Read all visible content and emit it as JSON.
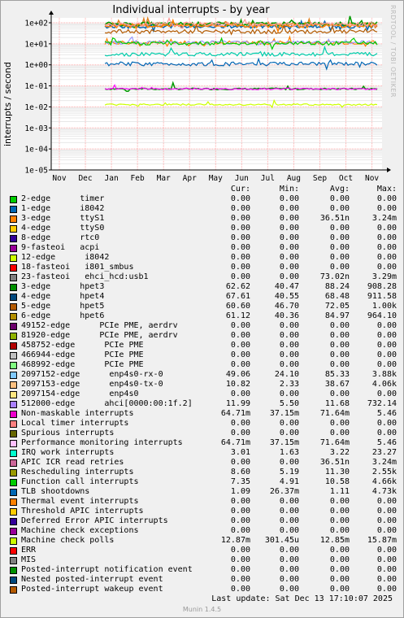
{
  "title": "Individual interrupts - by year",
  "watermark": "RRDTOOL / TOBI OETIKER",
  "chart_data": {
    "type": "line",
    "title": "Individual interrupts - by year",
    "ylabel": "interrupts / second",
    "yscale": "log",
    "ylim": [
      1e-05,
      100
    ],
    "ytick_labels": [
      "1e-05",
      "1e-04",
      "1e-03",
      "1e-02",
      "1e-01",
      "1e+00",
      "1e+01",
      "1e+02"
    ],
    "ytick_values": [
      1e-05,
      0.0001,
      0.001,
      0.01,
      0.1,
      1,
      10,
      100
    ],
    "x_categories": [
      "Nov",
      "Dec",
      "Jan",
      "Feb",
      "Mar",
      "Apr",
      "May",
      "Jun",
      "Jul",
      "Aug",
      "Sep",
      "Oct",
      "Nov"
    ],
    "grid": true,
    "data_start": "Jan",
    "series": [
      {
        "name": "Performance monitoring interrupts",
        "color": "#009900",
        "value": 0.0716
      },
      {
        "name": "hpet6",
        "color": "#e08020",
        "value": 85
      },
      {
        "name": "hpet4",
        "color": "#0066b3",
        "value": 68
      },
      {
        "name": "hpet3",
        "color": "#009900",
        "value": 88
      },
      {
        "name": "hpet5",
        "color": "#ff8000",
        "value": 72
      },
      {
        "name": "enp4s0-rx-0",
        "color": "#ff9999",
        "value": 85
      },
      {
        "name": "enp4s0-tx-0",
        "color": "#b35a00",
        "value": 38
      },
      {
        "name": "Rescheduling interrupts",
        "color": "#ff8000",
        "value": 11.3
      },
      {
        "name": "ahci[0000:00:1f.2]",
        "color": "#9999ff",
        "value": 11.7
      },
      {
        "name": "Function call interrupts",
        "color": "#00cc00",
        "value": 10.6
      },
      {
        "name": "IRQ work interrupts",
        "color": "#00ccaa",
        "value": 3.2
      },
      {
        "name": "TLB shootdowns",
        "color": "#0066b3",
        "value": 1.1
      },
      {
        "name": "Local timer interrupts",
        "color": "#ff00ff",
        "value": 0.0716
      },
      {
        "name": "Machine check polls",
        "color": "#ccff00",
        "value": 0.01285
      }
    ]
  },
  "legend": {
    "headers": {
      "cur": "Cur:",
      "min": "Min:",
      "avg": "Avg:",
      "max": "Max:"
    },
    "rows": [
      {
        "name": "2-edge      timer",
        "color": "#00cc00",
        "cur": "0.00",
        "min": "0.00",
        "avg": "0.00",
        "max": "0.00"
      },
      {
        "name": "1-edge      i8042",
        "color": "#0066b3",
        "cur": "0.00",
        "min": "0.00",
        "avg": "0.00",
        "max": "0.00"
      },
      {
        "name": "3-edge      ttyS1",
        "color": "#ff8000",
        "cur": "0.00",
        "min": "0.00",
        "avg": "36.51n",
        "max": "3.24m"
      },
      {
        "name": "4-edge      ttyS0",
        "color": "#ffcc00",
        "cur": "0.00",
        "min": "0.00",
        "avg": "0.00",
        "max": "0.00"
      },
      {
        "name": "8-edge      rtc0",
        "color": "#330099",
        "cur": "0.00",
        "min": "0.00",
        "avg": "0.00",
        "max": "0.00"
      },
      {
        "name": "9-fasteoi   acpi",
        "color": "#990099",
        "cur": "0.00",
        "min": "0.00",
        "avg": "0.00",
        "max": "0.00"
      },
      {
        "name": "12-edge      i8042",
        "color": "#ccff00",
        "cur": "0.00",
        "min": "0.00",
        "avg": "0.00",
        "max": "0.00"
      },
      {
        "name": "18-fasteoi   i801_smbus",
        "color": "#ff0000",
        "cur": "0.00",
        "min": "0.00",
        "avg": "0.00",
        "max": "0.00"
      },
      {
        "name": "23-fasteoi   ehci_hcd:usb1",
        "color": "#808080",
        "cur": "0.00",
        "min": "0.00",
        "avg": "73.02n",
        "max": "3.29m"
      },
      {
        "name": "3-edge      hpet3",
        "color": "#008f00",
        "cur": "62.62",
        "min": "40.47",
        "avg": "88.24",
        "max": "908.28"
      },
      {
        "name": "4-edge      hpet4",
        "color": "#00487d",
        "cur": "67.61",
        "min": "40.55",
        "avg": "68.48",
        "max": "911.58"
      },
      {
        "name": "5-edge      hpet5",
        "color": "#b35a00",
        "cur": "60.60",
        "min": "46.70",
        "avg": "72.05",
        "max": "1.00k"
      },
      {
        "name": "6-edge      hpet6",
        "color": "#b38f00",
        "cur": "61.12",
        "min": "40.36",
        "avg": "84.97",
        "max": "964.10"
      },
      {
        "name": "49152-edge      PCIe PME, aerdrv",
        "color": "#6b006b",
        "cur": "0.00",
        "min": "0.00",
        "avg": "0.00",
        "max": "0.00"
      },
      {
        "name": "81920-edge      PCIe PME, aerdrv",
        "color": "#8fb300",
        "cur": "0.00",
        "min": "0.00",
        "avg": "0.00",
        "max": "0.00"
      },
      {
        "name": "458752-edge      PCIe PME",
        "color": "#b30000",
        "cur": "0.00",
        "min": "0.00",
        "avg": "0.00",
        "max": "0.00"
      },
      {
        "name": "466944-edge      PCIe PME",
        "color": "#bebebe",
        "cur": "0.00",
        "min": "0.00",
        "avg": "0.00",
        "max": "0.00"
      },
      {
        "name": "468992-edge      PCIe PME",
        "color": "#80ff80",
        "cur": "0.00",
        "min": "0.00",
        "avg": "0.00",
        "max": "0.00"
      },
      {
        "name": "2097152-edge      enp4s0-rx-0",
        "color": "#80c9ff",
        "cur": "49.06",
        "min": "24.10",
        "avg": "85.33",
        "max": "3.88k"
      },
      {
        "name": "2097153-edge      enp4s0-tx-0",
        "color": "#ffc080",
        "cur": "10.82",
        "min": "2.33",
        "avg": "38.67",
        "max": "4.06k"
      },
      {
        "name": "2097154-edge      enp4s0",
        "color": "#ffe680",
        "cur": "0.00",
        "min": "0.00",
        "avg": "0.00",
        "max": "0.00"
      },
      {
        "name": "512000-edge      ahci[0000:00:1f.2]",
        "color": "#aa80ff",
        "cur": "11.99",
        "min": "5.50",
        "avg": "11.68",
        "max": "732.14"
      },
      {
        "name": "Non-maskable interrupts",
        "color": "#ee00cc",
        "cur": "64.71m",
        "min": "37.15m",
        "avg": "71.64m",
        "max": "5.46"
      },
      {
        "name": "Local timer interrupts",
        "color": "#ff8080",
        "cur": "0.00",
        "min": "0.00",
        "avg": "0.00",
        "max": "0.00"
      },
      {
        "name": "Spurious interrupts",
        "color": "#666600",
        "cur": "0.00",
        "min": "0.00",
        "avg": "0.00",
        "max": "0.00"
      },
      {
        "name": "Performance monitoring interrupts",
        "color": "#ffbfff",
        "cur": "64.71m",
        "min": "37.15m",
        "avg": "71.64m",
        "max": "5.46"
      },
      {
        "name": "IRQ work interrupts",
        "color": "#00ffcc",
        "cur": "3.01",
        "min": "1.63",
        "avg": "3.22",
        "max": "23.27"
      },
      {
        "name": "APIC ICR read retries",
        "color": "#cc6699",
        "cur": "0.00",
        "min": "0.00",
        "avg": "36.51n",
        "max": "3.24m"
      },
      {
        "name": "Rescheduling interrupts",
        "color": "#999900",
        "cur": "8.60",
        "min": "5.19",
        "avg": "11.30",
        "max": "2.55k"
      },
      {
        "name": "Function call interrupts",
        "color": "#00cc00",
        "cur": "7.35",
        "min": "4.91",
        "avg": "10.58",
        "max": "4.66k"
      },
      {
        "name": "TLB shootdowns",
        "color": "#0066b3",
        "cur": "1.09",
        "min": "26.37m",
        "avg": "1.11",
        "max": "4.73k"
      },
      {
        "name": "Thermal event interrupts",
        "color": "#ff8000",
        "cur": "0.00",
        "min": "0.00",
        "avg": "0.00",
        "max": "0.00"
      },
      {
        "name": "Threshold APIC interrupts",
        "color": "#ffcc00",
        "cur": "0.00",
        "min": "0.00",
        "avg": "0.00",
        "max": "0.00"
      },
      {
        "name": "Deferred Error APIC interrupts",
        "color": "#330099",
        "cur": "0.00",
        "min": "0.00",
        "avg": "0.00",
        "max": "0.00"
      },
      {
        "name": "Machine check exceptions",
        "color": "#990099",
        "cur": "0.00",
        "min": "0.00",
        "avg": "0.00",
        "max": "0.00"
      },
      {
        "name": "Machine check polls",
        "color": "#ccff00",
        "cur": "12.87m",
        "min": "301.45u",
        "avg": "12.85m",
        "max": "15.87m"
      },
      {
        "name": "ERR",
        "color": "#ff0000",
        "cur": "0.00",
        "min": "0.00",
        "avg": "0.00",
        "max": "0.00"
      },
      {
        "name": "MIS",
        "color": "#808080",
        "cur": "0.00",
        "min": "0.00",
        "avg": "0.00",
        "max": "0.00"
      },
      {
        "name": "Posted-interrupt notification event",
        "color": "#008f00",
        "cur": "0.00",
        "min": "0.00",
        "avg": "0.00",
        "max": "0.00"
      },
      {
        "name": "Nested posted-interrupt event",
        "color": "#00487d",
        "cur": "0.00",
        "min": "0.00",
        "avg": "0.00",
        "max": "0.00"
      },
      {
        "name": "Posted-interrupt wakeup event",
        "color": "#b35a00",
        "cur": "0.00",
        "min": "0.00",
        "avg": "0.00",
        "max": "0.00"
      }
    ]
  },
  "footer": {
    "last_update": "Last update:  Sat Dec 13 17:10:07 2025"
  },
  "generator": "Munin 1.4.5"
}
